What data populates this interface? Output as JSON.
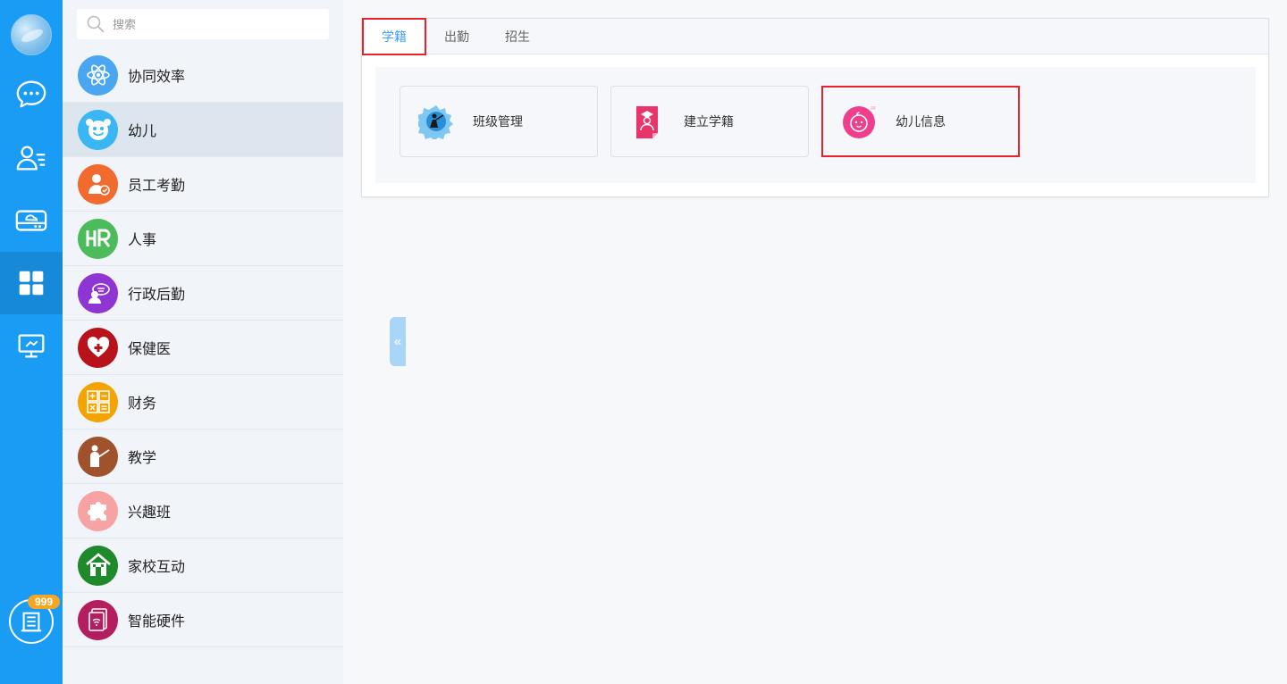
{
  "rail": {
    "items": [
      {
        "icon": "chat-bubble-icon"
      },
      {
        "icon": "contacts-icon"
      },
      {
        "icon": "cloud-drive-icon"
      },
      {
        "icon": "apps-grid-icon"
      },
      {
        "icon": "monitor-icon"
      }
    ],
    "badge": "999",
    "bottom_icon": "building-icon"
  },
  "search": {
    "placeholder": "搜索"
  },
  "menu": {
    "items": [
      {
        "label": "协同效率",
        "icon": "atom-icon",
        "color": "#4aa6f0"
      },
      {
        "label": "幼儿",
        "icon": "smiley-icon",
        "color": "#39b6f3"
      },
      {
        "label": "员工考勤",
        "icon": "employee-clock-icon",
        "color": "#f06b2d"
      },
      {
        "label": "人事",
        "icon": "hr-icon",
        "color": "#4cbb5b"
      },
      {
        "label": "行政后勤",
        "icon": "admin-icon",
        "color": "#8e35d4"
      },
      {
        "label": "保健医",
        "icon": "heart-medical-icon",
        "color": "#b8121b"
      },
      {
        "label": "财务",
        "icon": "calculator-icon",
        "color": "#f5a300"
      },
      {
        "label": "教学",
        "icon": "teacher-icon",
        "color": "#a0522d"
      },
      {
        "label": "兴趣班",
        "icon": "puzzle-icon",
        "color": "#f7a3a3"
      },
      {
        "label": "家校互动",
        "icon": "house-icon",
        "color": "#1f8a2c"
      },
      {
        "label": "智能硬件",
        "icon": "smart-device-icon",
        "color": "#b41e5e"
      }
    ]
  },
  "tabs": [
    {
      "label": "学籍"
    },
    {
      "label": "出勤"
    },
    {
      "label": "招生"
    }
  ],
  "cards": [
    {
      "label": "班级管理",
      "icon": "class-badge-icon",
      "color": "#2a8fd9"
    },
    {
      "label": "建立学籍",
      "icon": "student-document-icon",
      "color": "#e8336b"
    },
    {
      "label": "幼儿信息",
      "icon": "baby-face-icon",
      "color": "#ef3f8c"
    }
  ]
}
